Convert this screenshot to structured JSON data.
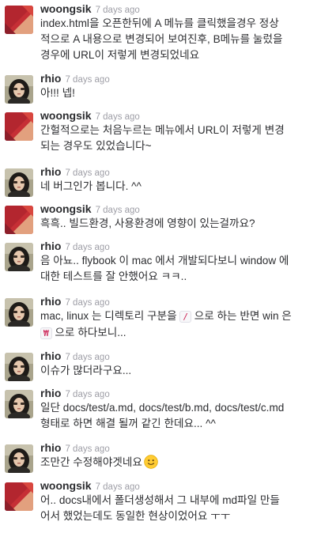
{
  "colors": {
    "author": "#2c2d30",
    "timestamp": "#9e9ea6",
    "code_text": "#cc2255",
    "code_bg": "#f7f7f9"
  },
  "messages": [
    {
      "author": "woongsik",
      "time": "7 days ago",
      "lines": [
        "index.html을 오픈한뒤에 A 메뉴를 클릭했을경우 정상",
        "적으로 A 내용으로 변경되어 보여진후, B메뉴를 눌렀을",
        "경우에 URL이 저렇게 변경되었네요"
      ]
    },
    {
      "author": "rhio",
      "time": "7 days ago",
      "lines": [
        "아!!! 넵!"
      ]
    },
    {
      "author": "woongsik",
      "time": "7 days ago",
      "lines": [
        "간헐적으로는 처음누르는 메뉴에서 URL이 저렇게 변경",
        "되는 경우도 있었습니다~"
      ]
    },
    {
      "author": "rhio",
      "time": "7 days ago",
      "lines": [
        "네 버그인가 봅니다. ^^"
      ]
    },
    {
      "author": "woongsik",
      "time": "7 days ago",
      "lines": [
        "흑흑.. 빌드환경, 사용환경에 영향이 있는걸까요?"
      ]
    },
    {
      "author": "rhio",
      "time": "7 days ago",
      "lines": [
        "음 아뇨.. flybook 이 mac 에서 개발되다보니 window 에",
        "대한 테스트를 잘 안했어요 ㅋㅋ.."
      ]
    },
    {
      "author": "rhio",
      "time": "7 days ago",
      "line1_before": "mac, linux 는 디렉토리 구분을 ",
      "code1": "/",
      "line1_after": " 으로 하는 반면 win 은",
      "code2": "₩",
      "line2_after": " 으로 하다보니..."
    },
    {
      "author": "rhio",
      "time": "7 days ago",
      "lines": [
        "이슈가 많더라구요..."
      ]
    },
    {
      "author": "rhio",
      "time": "7 days ago",
      "lines": [
        "일단 docs/test/a.md, docs/test/b.md, docs/test/c.md",
        "형태로 하면 해결 될꺼 같긴 한데요... ^^"
      ]
    },
    {
      "author": "rhio",
      "time": "7 days ago",
      "lines": [
        "조만간 수정해야겟네요"
      ],
      "emoji": "slightly-smiling-face"
    },
    {
      "author": "woongsik",
      "time": "7 days ago",
      "lines": [
        "어.. docs내에서 폴더생성해서 그 내부에 md파일 만들",
        "어서 했었는데도 동일한 현상이었어요 ㅜㅜ"
      ]
    }
  ]
}
